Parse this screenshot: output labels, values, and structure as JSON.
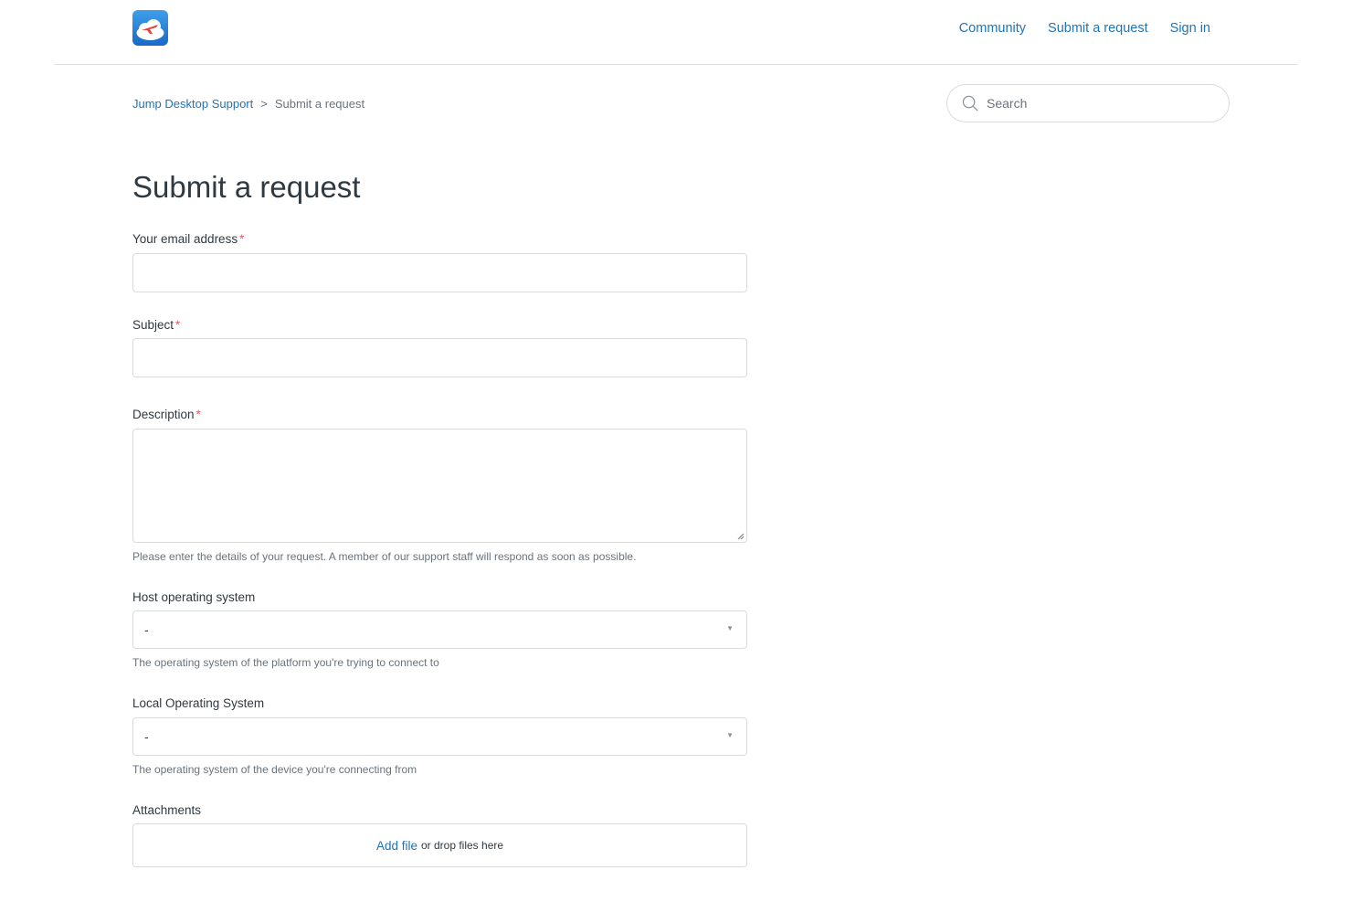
{
  "header": {
    "logo_icon": "cloud-plane-icon",
    "nav": {
      "community": "Community",
      "submit_request": "Submit a request",
      "sign_in": "Sign in"
    },
    "link_color": "#1f73b7"
  },
  "breadcrumb": {
    "home": "Jump Desktop Support",
    "separator": ">",
    "current": "Submit a request"
  },
  "search": {
    "placeholder": "Search",
    "icon": "search-icon"
  },
  "page": {
    "title": "Submit a request"
  },
  "form": {
    "email": {
      "label": "Your email address",
      "required_marker": "*",
      "value": ""
    },
    "subject": {
      "label": "Subject",
      "required_marker": "*",
      "value": ""
    },
    "description": {
      "label": "Description",
      "required_marker": "*",
      "value": "",
      "hint": "Please enter the details of your request. A member of our support staff will respond as soon as possible."
    },
    "host_os": {
      "label": "Host operating system",
      "value": "-",
      "hint": "The operating system of the platform you're trying to connect to"
    },
    "local_os": {
      "label": "Local Operating System",
      "value": "-",
      "hint": "The operating system of the device you're connecting from"
    },
    "attachments": {
      "label": "Attachments",
      "add_file": "Add file",
      "drop_text": "or drop files here"
    }
  },
  "colors": {
    "required": "#e35b66",
    "border": "#d8dcde"
  }
}
